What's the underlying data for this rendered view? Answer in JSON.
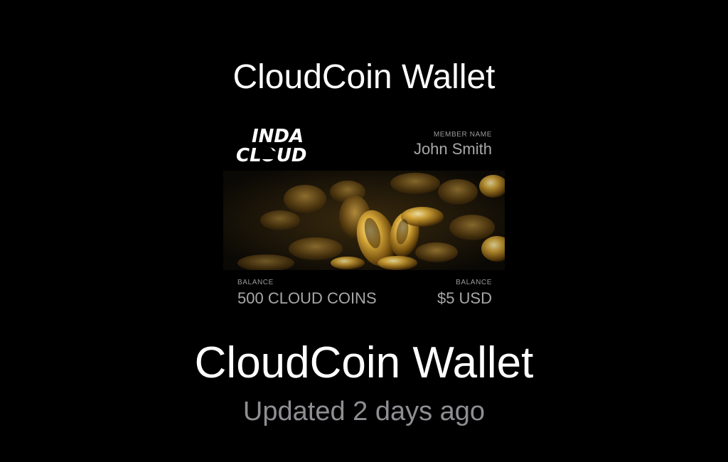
{
  "header": {
    "title": "CloudCoin Wallet"
  },
  "pass": {
    "logo": {
      "line1": "INDA",
      "line2": "CLOUD",
      "icon": "cloud-icon"
    },
    "member": {
      "label": "MEMBER NAME",
      "value": "John Smith"
    },
    "strip_image": "gold-coins-image",
    "balance_coins": {
      "label": "BALANCE",
      "value": "500 CLOUD COINS"
    },
    "balance_usd": {
      "label": "BALANCE",
      "value": "$5 USD"
    }
  },
  "footer": {
    "title": "CloudCoin Wallet",
    "subtitle": "Updated 2 days ago"
  },
  "colors": {
    "background": "#000000",
    "title": "#ffffff",
    "subtitle": "#8e8e93",
    "gold": "#c9a23a"
  }
}
